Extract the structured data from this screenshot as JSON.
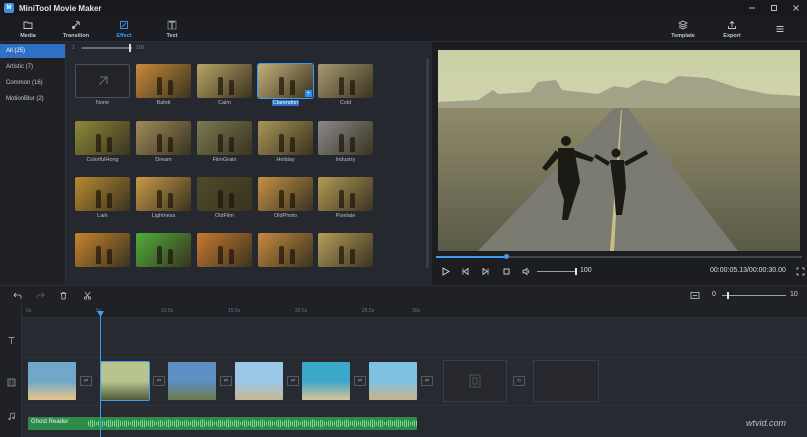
{
  "app": {
    "title": "MiniTool Movie Maker",
    "logo_text": "M"
  },
  "window_controls": [
    "minimize-icon",
    "maximize-icon",
    "close-icon"
  ],
  "toolbar": {
    "left": [
      {
        "id": "media",
        "label": "Media",
        "icon": "folder-icon"
      },
      {
        "id": "transition",
        "label": "Transition",
        "icon": "transition-icon"
      },
      {
        "id": "effect",
        "label": "Effect",
        "icon": "effect-icon",
        "active": true
      },
      {
        "id": "text",
        "label": "Text",
        "icon": "text-icon"
      }
    ],
    "right": [
      {
        "id": "template",
        "label": "Template",
        "icon": "layers-icon"
      },
      {
        "id": "export",
        "label": "Export",
        "icon": "export-icon"
      },
      {
        "id": "menu",
        "label": "",
        "icon": "hamburger-menu-icon"
      }
    ]
  },
  "categories": [
    {
      "label": "All (25)",
      "active": true
    },
    {
      "label": "Artistic (7)"
    },
    {
      "label": "Common (16)"
    },
    {
      "label": "MotionBlur (2)"
    }
  ],
  "effect_slider": {
    "min_label": "1",
    "max_label": "100"
  },
  "effects": [
    {
      "label": "None",
      "tone": "none"
    },
    {
      "label": "Bafeti",
      "tone": "#c98b3a"
    },
    {
      "label": "Calm",
      "tone": "#b9a366"
    },
    {
      "label": "Clarendon",
      "tone": "#c4b07a",
      "selected": true
    },
    {
      "label": "Cold",
      "tone": "#a69a70"
    },
    {
      "label": "ColorfulHong",
      "tone": "#8d8a3a"
    },
    {
      "label": "Dream",
      "tone": "#9f8c5c"
    },
    {
      "label": "FilmGrain",
      "tone": "#7b7a52"
    },
    {
      "label": "Holiday",
      "tone": "#a99658"
    },
    {
      "label": "Industry",
      "tone": "#8a8a8a"
    },
    {
      "label": "Lark",
      "tone": "#b78a30"
    },
    {
      "label": "Lightness",
      "tone": "#c89a48"
    },
    {
      "label": "OldFilm",
      "tone": "#4f4a2a"
    },
    {
      "label": "OldPhoto",
      "tone": "#c49245"
    },
    {
      "label": "Pixelate",
      "tone": "#b29a55"
    },
    {
      "label": "",
      "tone": "#c7842e"
    },
    {
      "label": "",
      "tone": "#4fae3c"
    },
    {
      "label": "",
      "tone": "#c97a30"
    },
    {
      "label": "",
      "tone": "#c68a40"
    },
    {
      "label": "",
      "tone": "#b59d5a"
    }
  ],
  "player": {
    "volume": "100",
    "timecode": "00:00:05.13/00:00:30.00",
    "progress_fraction": 0.19,
    "volume_fraction": 1.0
  },
  "timeline_toolbar": {
    "tools": [
      "undo-icon",
      "redo-icon",
      "delete-icon",
      "split-icon"
    ],
    "zoom_min": "0",
    "zoom_max": "10",
    "zoom_fraction": 0.08
  },
  "ruler_ticks": [
    "0s",
    "5s",
    "10.5s",
    "15.5s",
    "20.5s",
    "25.5s",
    "30s"
  ],
  "track_icons": [
    "text-track-icon",
    "video-track-icon",
    "music-track-icon"
  ],
  "clips": [
    {
      "scene": "plane",
      "colors": [
        "#6fa8c9",
        "#e9c48a"
      ]
    },
    {
      "scene": "road",
      "colors": [
        "#b8c48e",
        "#4f5a3a"
      ],
      "selected": true
    },
    {
      "scene": "mountain",
      "colors": [
        "#5e8fc4",
        "#6d7b4a"
      ]
    },
    {
      "scene": "hiker",
      "colors": [
        "#9bc7e8",
        "#c7b894"
      ]
    },
    {
      "scene": "beach",
      "colors": [
        "#3ba7c9",
        "#d9c49a"
      ]
    },
    {
      "scene": "coast",
      "colors": [
        "#7fc1e2",
        "#c9b48a"
      ]
    }
  ],
  "audio": {
    "label": "Ghost Reader"
  },
  "watermark": "wtvid.com"
}
